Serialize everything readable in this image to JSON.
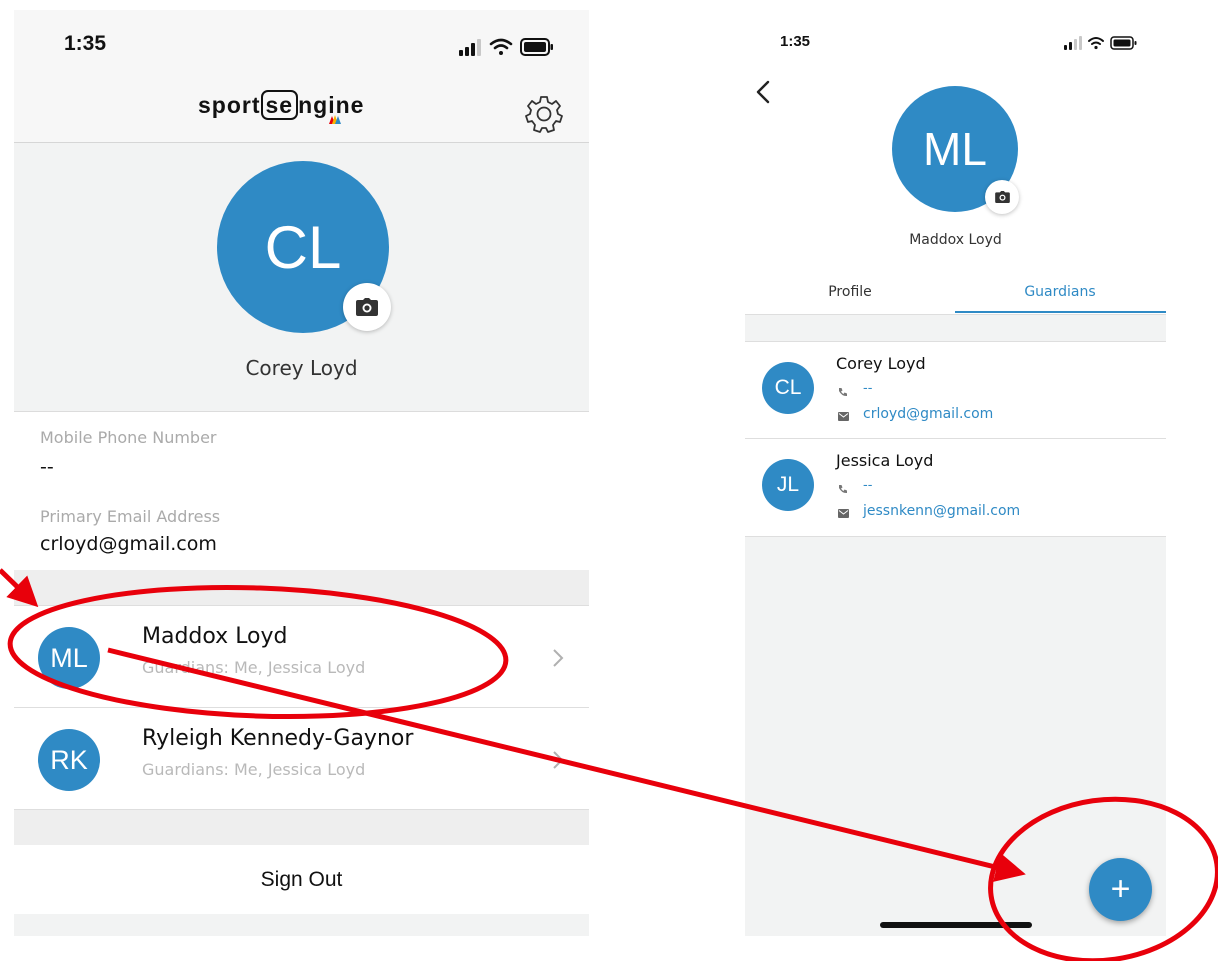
{
  "left_screen": {
    "status_time": "1:35",
    "logo": {
      "part1": "sport",
      "part2": "se",
      "part3": "ngine"
    },
    "profile": {
      "initials": "CL",
      "name": "Corey Loyd"
    },
    "fields": [
      {
        "label": "Mobile Phone Number",
        "value": "--"
      },
      {
        "label": "Primary Email Address",
        "value": "crloyd@gmail.com"
      }
    ],
    "children": [
      {
        "initials": "ML",
        "name": "Maddox Loyd",
        "subtitle": "Guardians: Me, Jessica Loyd"
      },
      {
        "initials": "RK",
        "name": "Ryleigh Kennedy-Gaynor",
        "subtitle": "Guardians: Me, Jessica Loyd"
      }
    ],
    "sign_out_label": "Sign Out"
  },
  "right_screen": {
    "status_time": "1:35",
    "profile": {
      "initials": "ML",
      "name": "Maddox Loyd"
    },
    "tabs": [
      {
        "label": "Profile",
        "active": false
      },
      {
        "label": "Guardians",
        "active": true
      }
    ],
    "guardians": [
      {
        "initials": "CL",
        "name": "Corey Loyd",
        "phone": "--",
        "email": "crloyd@gmail.com"
      },
      {
        "initials": "JL",
        "name": "Jessica Loyd",
        "phone": "--",
        "email": "jessnkenn@gmail.com"
      }
    ],
    "fab_label": "+"
  },
  "colors": {
    "accent": "#2f8ac5",
    "annotation": "#e8000b",
    "background_gray": "#f2f3f3"
  },
  "icons": [
    "signal-icon",
    "wifi-icon",
    "battery-icon",
    "gear-icon",
    "camera-icon",
    "chevron-right-icon",
    "back-chevron-icon",
    "phone-icon",
    "mail-icon",
    "plus-icon"
  ]
}
